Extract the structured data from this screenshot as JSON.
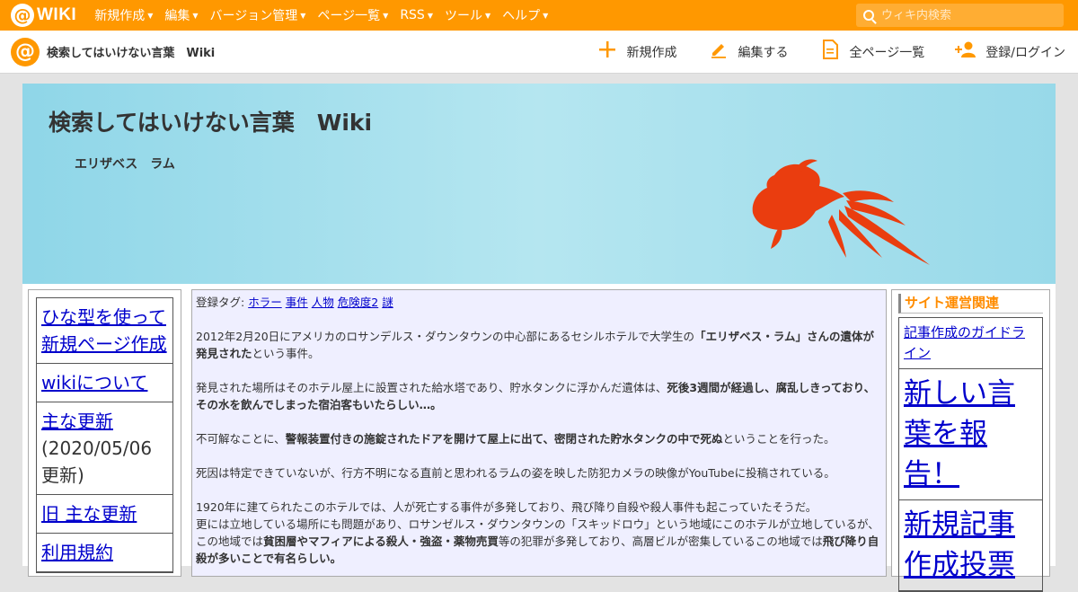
{
  "topbar": {
    "logo_text": "WIKI",
    "menu": [
      "新規作成",
      "編集",
      "バージョン管理",
      "ページ一覧",
      "RSS",
      "ツール",
      "ヘルプ"
    ],
    "search_placeholder": "ウィキ内検索"
  },
  "subbar": {
    "title": "検索してはいけない言葉　Wiki",
    "actions": [
      {
        "icon": "plus-icon",
        "label": "新規作成"
      },
      {
        "icon": "pencil-icon",
        "label": "編集する"
      },
      {
        "icon": "page-list-icon",
        "label": "全ページ一覧"
      },
      {
        "icon": "user-add-icon",
        "label": "登録/ログイン"
      }
    ]
  },
  "banner": {
    "title": "検索してはいけない言葉　Wiki",
    "subtitle": "エリザベス　ラム"
  },
  "left_nav": [
    {
      "link": "ひな型を使って新規ページ作成",
      "note": ""
    },
    {
      "link": "wikiについて",
      "note": ""
    },
    {
      "link": "主な更新",
      "note": "(2020/05/06更新)"
    },
    {
      "link": "旧 主な更新",
      "note": ""
    },
    {
      "link": "利用規約",
      "note": ""
    }
  ],
  "article": {
    "tags_label": "登録タグ:",
    "tags": [
      "ホラー",
      "事件",
      "人物",
      "危険度2",
      "謎"
    ],
    "p1_a": "2012年2月20日にアメリカのロサンデルス・ダウンタウンの中心部にあるセシルホテルで大学生の",
    "p1_b": "「エリザベス・ラム」さんの遺体が発見された",
    "p1_c": "という事件。",
    "p2_a": "発見された場所はそのホテル屋上に設置された給水塔であり、貯水タンクに浮かんだ遺体は、",
    "p2_b": "死後3週間が経過し、腐乱しきっており、その水を飲んでしまった宿泊客もいたらしい…。",
    "p3_a": "不可解なことに、",
    "p3_b": "警報装置付きの施錠されたドアを開けて屋上に出て、密閉された貯水タンクの中で死ぬ",
    "p3_c": "ということを行った。",
    "p4": "死因は特定できていないが、行方不明になる直前と思われるラムの姿を映した防犯カメラの映像がYouTubeに投稿されている。",
    "p5_line1": "1920年に建てられたこのホテルでは、人が死亡する事件が多発しており、飛び降り自殺や殺人事件も起こっていたそうだ。",
    "p5_a": "更には立地している場所にも問題があり、ロサンゼルス・ダウンタウンの「スキッドロウ」という地域にこのホテルが立地しているが、この地域では",
    "p5_b": "貧困層やマフィアによる殺人・強盗・薬物売買",
    "p5_c": "等の犯罪が多発しており、高層ビルが密集しているこの地域では",
    "p5_d": "飛び降り自殺が多いことで有名らしい。"
  },
  "right_nav": {
    "heading": "サイト運営関連",
    "items": [
      {
        "label": "記事作成のガイドライン",
        "size": "small"
      },
      {
        "label": "新しい言葉を報告！",
        "size": "large"
      },
      {
        "label": "新規記事作成投票",
        "size": "large"
      }
    ]
  },
  "colors": {
    "brand": "#ff9800",
    "link": "#0000cc",
    "fish": "#ea3d0f"
  }
}
